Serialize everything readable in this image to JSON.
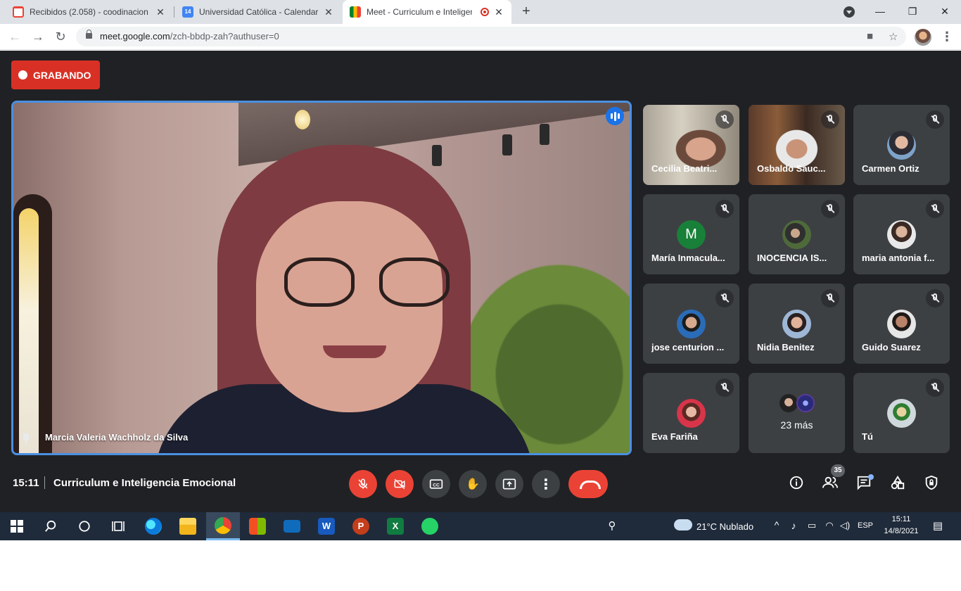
{
  "browser": {
    "tabs": [
      {
        "label": "Recibidos (2.058) - coodinacion",
        "favicon_text": "10+",
        "icon": "gmail-icon"
      },
      {
        "label": "Universidad Católica - Calendar -",
        "favicon_text": "14",
        "icon": "calendar-icon"
      },
      {
        "label": "Meet - Curriculum e Inteligen",
        "icon": "meet-icon",
        "recording": true
      }
    ],
    "url_host": "meet.google.com",
    "url_path": "/zch-bbdp-zah?authuser=0"
  },
  "meet": {
    "recording_label": "GRABANDO",
    "main_speaker": "Marcia Valeria Wachholz da Silva",
    "participants": [
      {
        "name": "Cecilia Beatri...",
        "type": "camera"
      },
      {
        "name": "Osbaldo Sauc...",
        "type": "camera"
      },
      {
        "name": "Carmen Ortiz",
        "type": "avatar"
      },
      {
        "name": "María Inmacula...",
        "type": "letter",
        "letter": "M"
      },
      {
        "name": "INOCENCIA IS...",
        "type": "avatar"
      },
      {
        "name": "maria antonia f...",
        "type": "avatar"
      },
      {
        "name": "jose centurion ...",
        "type": "avatar"
      },
      {
        "name": "Nidia Benitez",
        "type": "avatar"
      },
      {
        "name": "Guido Suarez",
        "type": "avatar"
      },
      {
        "name": "Eva Fariña",
        "type": "avatar"
      },
      {
        "name": "Tú",
        "type": "avatar"
      }
    ],
    "more_label": "23 más",
    "time": "15:11",
    "meeting_title": "Curriculum e Inteligencia Emocional",
    "participant_count": "35"
  },
  "taskbar": {
    "weather": "21°C  Nublado",
    "language": "ESP",
    "time": "15:11",
    "date": "14/8/2021"
  },
  "colors": {
    "meet_bg": "#202124",
    "record_red": "#d93025",
    "speaker_border": "#4a90e2",
    "tile_bg": "#3c4043",
    "taskbar_bg": "#1f2b3b"
  }
}
